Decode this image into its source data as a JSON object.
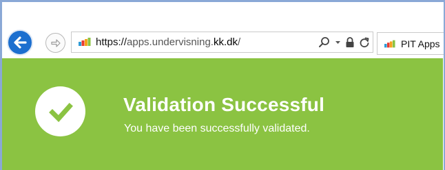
{
  "browser": {
    "address": {
      "url_scheme": "https://",
      "url_host_pre": "apps.undervisning.",
      "url_host_strong": "kk.dk",
      "url_path": "/"
    },
    "tab": {
      "label": "PIT Apps"
    },
    "icons": {
      "back": "back-arrow-icon",
      "forward": "forward-arrow-icon",
      "search": "search-icon",
      "dropdown": "chevron-down-icon",
      "lock": "lock-icon",
      "refresh": "refresh-icon"
    }
  },
  "banner": {
    "title": "Validation Successful",
    "subtitle": "You have been successfully validated.",
    "icon": "checkmark-icon",
    "background": "#8bc342"
  }
}
